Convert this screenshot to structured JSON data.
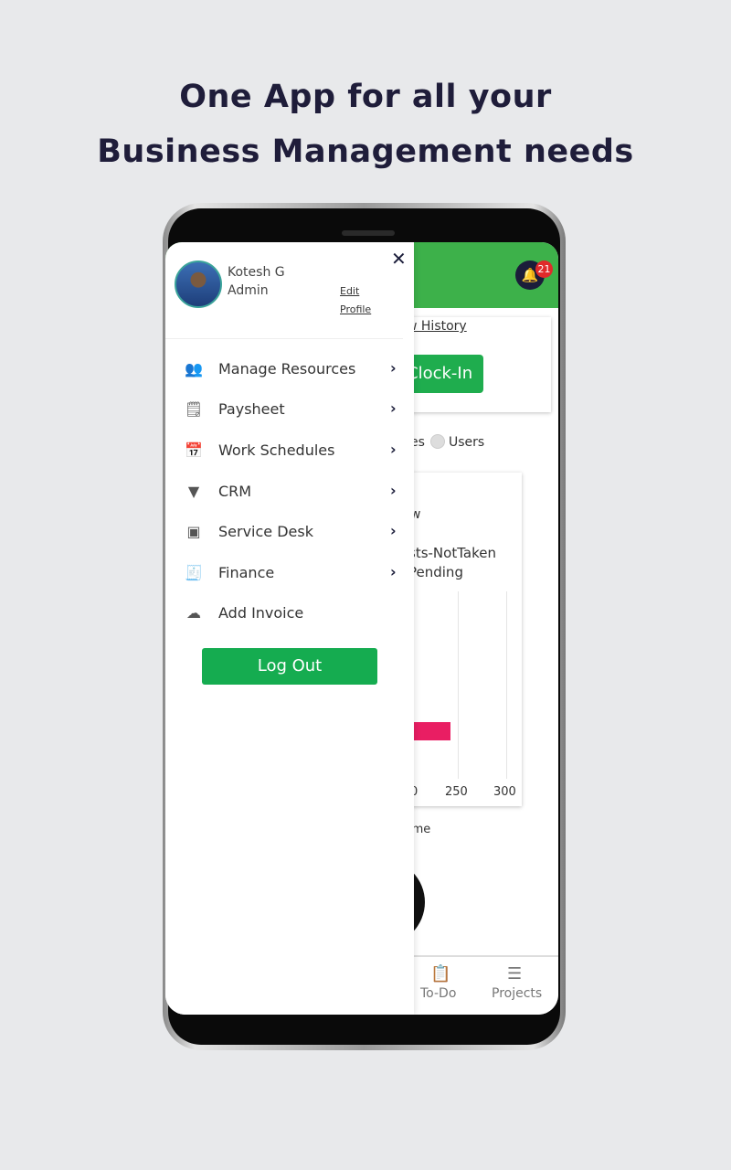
{
  "headline": {
    "line1": "One App for all your",
    "line2": "Business Management needs"
  },
  "colors": {
    "brand_green": "#3db14a",
    "button_green": "#15ac50",
    "navy": "#1b1d3a",
    "badge_red": "#e02a2a",
    "bar_pink": "#e91e63"
  },
  "background_app": {
    "notification_count": "21",
    "view_history": "w History",
    "clock_in": "Clock-In",
    "radio_labels": {
      "left": "es",
      "right": "Users"
    },
    "chart_title_partial": "w",
    "chart_legend": [
      "sts-NotTaken",
      "Pending"
    ],
    "axis_ticks": [
      "0",
      "250",
      "300"
    ],
    "section_label": "ime",
    "bottom_nav": [
      {
        "label": "To-Do",
        "icon": "clipboard-icon"
      },
      {
        "label": "Projects",
        "icon": "projects-add-icon"
      }
    ]
  },
  "drawer": {
    "user_name": "Kotesh G",
    "role": "Admin",
    "edit_profile": [
      "Edit",
      "Profile"
    ],
    "items": [
      {
        "label": "Manage Resources",
        "icon": "users-icon",
        "has_chevron": true
      },
      {
        "label": "Paysheet",
        "icon": "paysheet-icon",
        "has_chevron": true
      },
      {
        "label": "Work Schedules",
        "icon": "schedule-icon",
        "has_chevron": true
      },
      {
        "label": "CRM",
        "icon": "crm-funnel-icon",
        "has_chevron": true
      },
      {
        "label": "Service Desk",
        "icon": "service-desk-icon",
        "has_chevron": true
      },
      {
        "label": "Finance",
        "icon": "receipt-icon",
        "has_chevron": true
      },
      {
        "label": "Add Invoice",
        "icon": "cloud-lock-icon",
        "has_chevron": false
      }
    ],
    "logout": "Log Out"
  }
}
